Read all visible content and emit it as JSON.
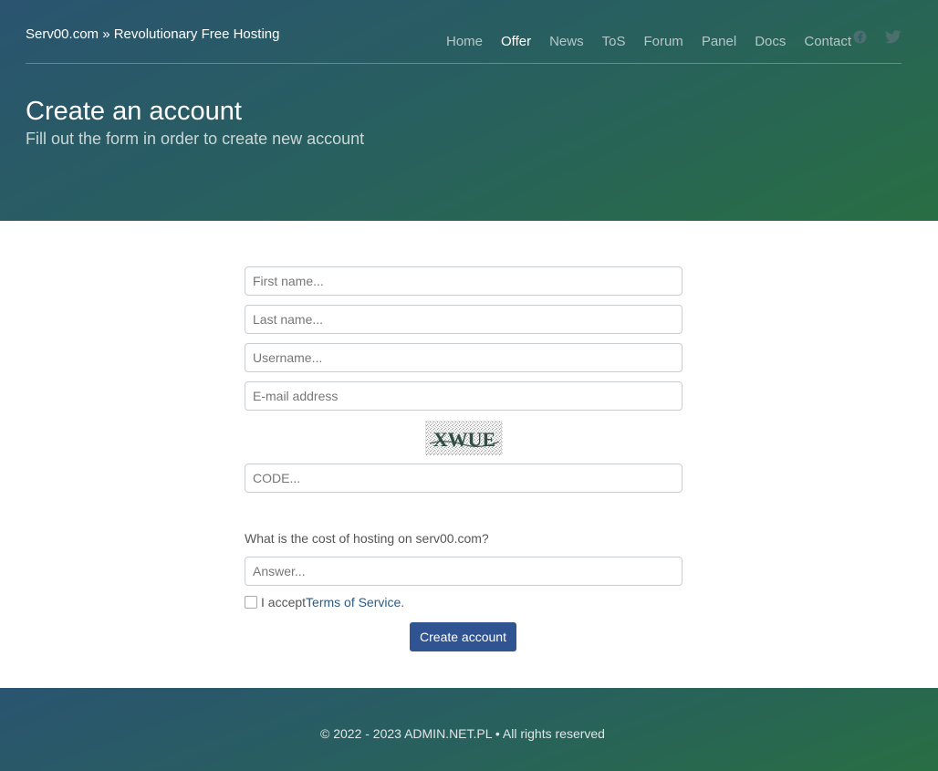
{
  "header": {
    "brand": "Serv00.com » Revolutionary Free Hosting",
    "nav": [
      "Home",
      "Offer",
      "News",
      "ToS",
      "Forum",
      "Panel",
      "Docs",
      "Contact"
    ],
    "active_nav": "Offer",
    "social_icons": [
      "facebook-icon",
      "twitter-icon"
    ],
    "title": "Create an account",
    "subtitle": "Fill out the form in order to create new account"
  },
  "form": {
    "first_name_placeholder": "First name...",
    "last_name_placeholder": "Last name...",
    "username_placeholder": "Username...",
    "email_placeholder": "E-mail address",
    "captcha_text": "XWUE",
    "code_placeholder": "CODE...",
    "question": "What is the cost of hosting on serv00.com?",
    "answer_placeholder": "Answer...",
    "accept_prefix": "I accept ",
    "terms_link": "Terms of Service",
    "accept_suffix": ".",
    "submit_label": "Create account"
  },
  "footer": {
    "copyright": "© 2022 - 2023 ADMIN.NET.PL • All rights reserved"
  },
  "colors": {
    "hero_gradient_start": "#2a5470",
    "hero_gradient_end": "#286e43",
    "button": "#2f5491",
    "link": "#2e5b82"
  }
}
